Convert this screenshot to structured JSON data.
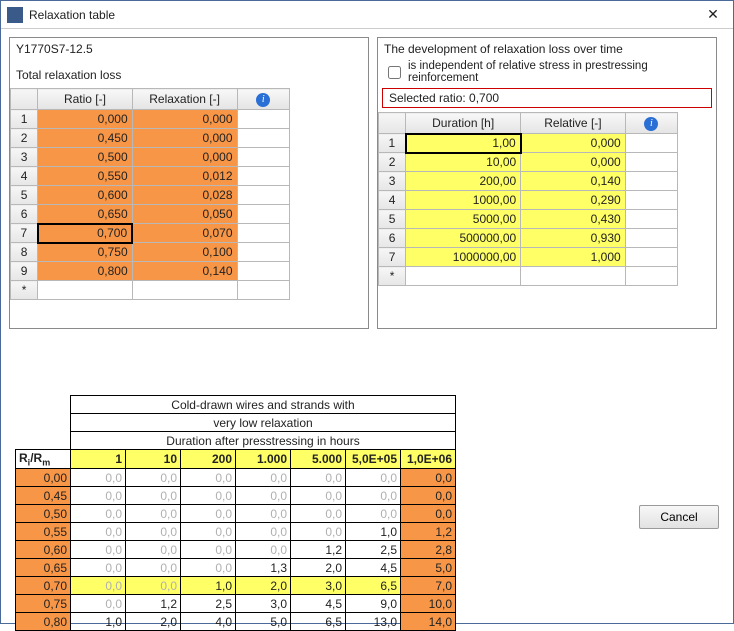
{
  "window": {
    "title": "Relaxation table",
    "close": "✕"
  },
  "left": {
    "code": "Y1770S7-12.5",
    "subtitle": "Total relaxation loss",
    "cols": {
      "c1": "Ratio [-]",
      "c2": "Relaxation [-]"
    },
    "rows": [
      {
        "n": "1",
        "ratio": "0,000",
        "relax": "0,000"
      },
      {
        "n": "2",
        "ratio": "0,450",
        "relax": "0,000"
      },
      {
        "n": "3",
        "ratio": "0,500",
        "relax": "0,000"
      },
      {
        "n": "4",
        "ratio": "0,550",
        "relax": "0,012"
      },
      {
        "n": "5",
        "ratio": "0,600",
        "relax": "0,028"
      },
      {
        "n": "6",
        "ratio": "0,650",
        "relax": "0,050"
      },
      {
        "n": "7",
        "ratio": "0,700",
        "relax": "0,070"
      },
      {
        "n": "8",
        "ratio": "0,750",
        "relax": "0,100"
      },
      {
        "n": "9",
        "ratio": "0,800",
        "relax": "0,140"
      }
    ]
  },
  "right": {
    "hdr": "The development of relaxation loss over time",
    "indep": "is independent of relative stress in prestressing reinforcement",
    "selected": "Selected ratio:  0,700",
    "cols": {
      "c1": "Duration [h]",
      "c2": "Relative [-]"
    },
    "rows": [
      {
        "n": "1",
        "dur": "1,00",
        "rel": "0,000"
      },
      {
        "n": "2",
        "dur": "10,00",
        "rel": "0,000"
      },
      {
        "n": "3",
        "dur": "200,00",
        "rel": "0,140"
      },
      {
        "n": "4",
        "dur": "1000,00",
        "rel": "0,290"
      },
      {
        "n": "5",
        "dur": "5000,00",
        "rel": "0,430"
      },
      {
        "n": "6",
        "dur": "500000,00",
        "rel": "0,930"
      },
      {
        "n": "7",
        "dur": "1000000,00",
        "rel": "1,000"
      }
    ]
  },
  "lookup": {
    "title1": "Cold-drawn wires and strands  with",
    "title2": "very low  relaxation",
    "title3": "Duration after presstressing in hours",
    "rowhdr_label": "R",
    "rowhdr_sub": "i",
    "rowhdr_label2": "/R",
    "rowhdr_sub2": "m",
    "col_hdrs": [
      "1",
      "10",
      "200",
      "1.000",
      "5.000",
      "5,0E+05",
      "1,0E+06"
    ],
    "rows": [
      {
        "r": "0,00",
        "v": [
          "0,0",
          "0,0",
          "0,0",
          "0,0",
          "0,0",
          "0,0",
          "0,0"
        ],
        "gray": [
          0,
          1,
          2,
          3,
          4,
          5
        ],
        "hi": [
          6
        ]
      },
      {
        "r": "0,45",
        "v": [
          "0,0",
          "0,0",
          "0,0",
          "0,0",
          "0,0",
          "0,0",
          "0,0"
        ],
        "gray": [
          0,
          1,
          2,
          3,
          4,
          5
        ],
        "hi": [
          6
        ]
      },
      {
        "r": "0,50",
        "v": [
          "0,0",
          "0,0",
          "0,0",
          "0,0",
          "0,0",
          "0,0",
          "0,0"
        ],
        "gray": [
          0,
          1,
          2,
          3,
          4,
          5
        ],
        "hi": [
          6
        ]
      },
      {
        "r": "0,55",
        "v": [
          "0,0",
          "0,0",
          "0,0",
          "0,0",
          "0,0",
          "1,0",
          "1,2"
        ],
        "gray": [
          0,
          1,
          2,
          3,
          4
        ],
        "hi": []
      },
      {
        "r": "0,60",
        "v": [
          "0,0",
          "0,0",
          "0,0",
          "0,0",
          "1,2",
          "2,5",
          "2,8"
        ],
        "gray": [
          0,
          1,
          2,
          3
        ],
        "hi": []
      },
      {
        "r": "0,65",
        "v": [
          "0,0",
          "0,0",
          "0,0",
          "1,3",
          "2,0",
          "4,5",
          "5,0"
        ],
        "gray": [
          0,
          1,
          2
        ],
        "hi": []
      },
      {
        "r": "0,70",
        "v": [
          "0,0",
          "0,0",
          "1,0",
          "2,0",
          "3,0",
          "6,5",
          "7,0"
        ],
        "gray": [],
        "yellowRow": true,
        "hi": []
      },
      {
        "r": "0,75",
        "v": [
          "0,0",
          "1,2",
          "2,5",
          "3,0",
          "4,5",
          "9,0",
          "10,0"
        ],
        "gray": [
          0
        ],
        "hi": [
          6
        ]
      },
      {
        "r": "0,80",
        "v": [
          "1,0",
          "2,0",
          "4,0",
          "5,0",
          "6,5",
          "13,0",
          "14,0"
        ],
        "gray": [],
        "hi": [
          6
        ]
      }
    ]
  },
  "buttons": {
    "cancel": "Cancel"
  }
}
